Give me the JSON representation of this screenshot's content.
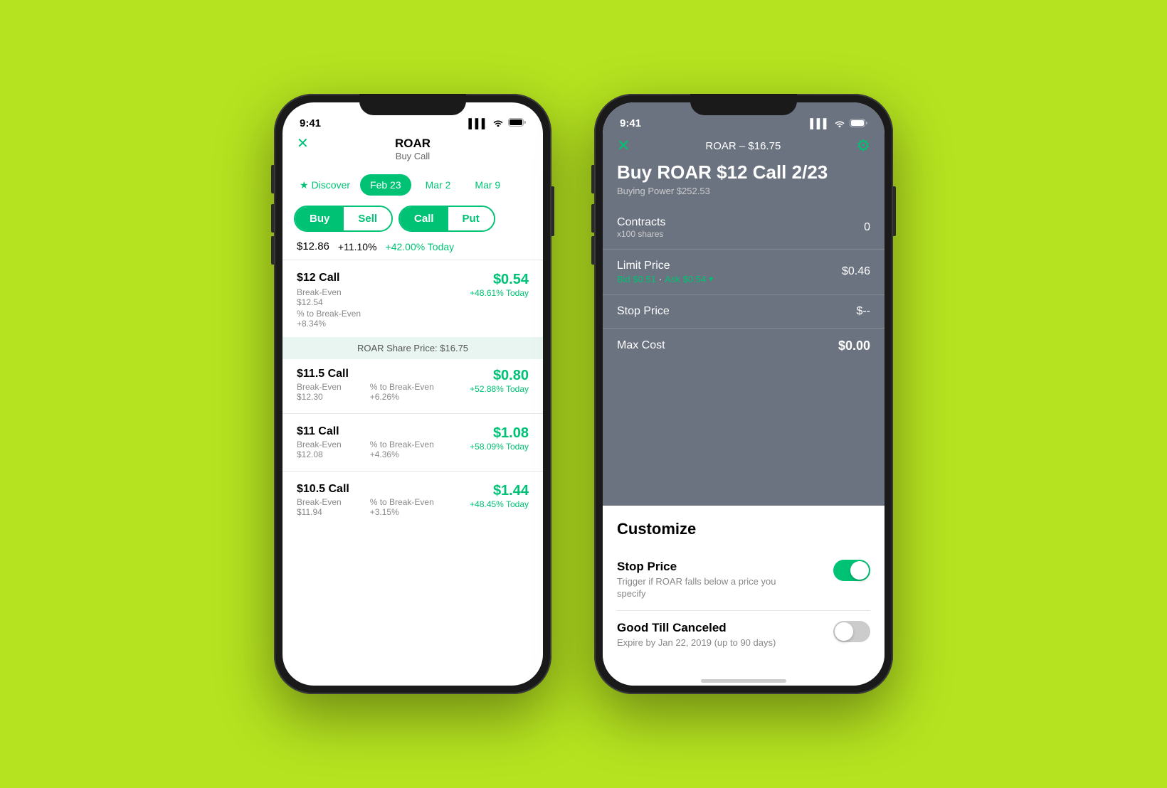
{
  "background": "#b5e320",
  "phone1": {
    "status": {
      "time": "9:41",
      "signal": "▌▌▌",
      "wifi": "wifi",
      "battery": "battery"
    },
    "header": {
      "close_icon": "✕",
      "title": "ROAR",
      "subtitle": "Buy Call"
    },
    "tabs": {
      "discover": "Discover",
      "dates": [
        "Feb 23",
        "Mar 2",
        "Mar 9"
      ],
      "active_date": "Feb 23"
    },
    "toggles": {
      "buy": "Buy",
      "sell": "Sell",
      "call": "Call",
      "put": "Put"
    },
    "price_row": {
      "price": "$12.86",
      "change": "+11.10%",
      "today_pct": "+42.00% Today"
    },
    "options": [
      {
        "name": "$12 Call",
        "breakeven_label": "Break-Even",
        "breakeven_value": "$12.54",
        "pct_label": "% to Break-Even",
        "pct_value": "+8.34%",
        "price": "$0.54",
        "today": "+48.61% Today"
      },
      {
        "name": "$11.5 Call",
        "breakeven_label": "Break-Even",
        "breakeven_value": "$12.30",
        "pct_label": "% to Break-Even",
        "pct_value": "+6.26%",
        "price": "$0.80",
        "today": "+52.88% Today"
      },
      {
        "name": "$11 Call",
        "breakeven_label": "Break-Even",
        "breakeven_value": "$12.08",
        "pct_label": "% to Break-Even",
        "pct_value": "+4.36%",
        "price": "$1.08",
        "today": "+58.09% Today"
      },
      {
        "name": "$10.5 Call",
        "breakeven_label": "Break-Even",
        "breakeven_value": "$11.94",
        "pct_label": "% to Break-Even",
        "pct_value": "+3.15%",
        "price": "$1.44",
        "today": "+48.45% Today"
      }
    ],
    "share_price_band": "ROAR Share Price: $16.75"
  },
  "phone2": {
    "status": {
      "time": "9:41",
      "signal": "▌▌▌",
      "wifi": "wifi",
      "battery": "battery"
    },
    "header": {
      "close_icon": "✕",
      "ticker": "ROAR – $16.75",
      "gear_icon": "⚙",
      "order_title": "Buy ROAR $12 Call 2/23",
      "buying_power": "Buying Power $252.53"
    },
    "form": {
      "contracts": {
        "label": "Contracts",
        "sublabel": "x100 shares",
        "value": "0"
      },
      "limit_price": {
        "label": "Limit Price",
        "bid": "Bid $0.51",
        "ask": "Ask $0.54",
        "value": "$0.46"
      },
      "stop_price": {
        "label": "Stop Price",
        "value": "$--"
      },
      "max_cost": {
        "label": "Max Cost",
        "value": "$0.00"
      }
    },
    "customize": {
      "title": "Customize",
      "stop_price": {
        "label": "Stop Price",
        "description": "Trigger if ROAR falls below a price you specify",
        "enabled": true
      },
      "good_till_canceled": {
        "label": "Good Till Canceled",
        "description": "Expire by Jan 22, 2019 (up to 90 days)",
        "enabled": false
      }
    }
  }
}
